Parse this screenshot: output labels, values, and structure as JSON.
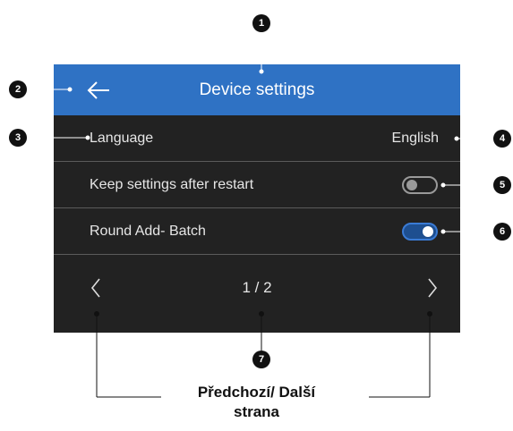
{
  "header": {
    "title": "Device settings",
    "back_icon": "arrow-left-icon"
  },
  "settings": [
    {
      "label": "Language",
      "value": "English"
    },
    {
      "label": "Keep settings after restart",
      "toggle": false
    },
    {
      "label": "Round Add- Batch",
      "toggle": true
    }
  ],
  "pager": {
    "indicator": "1 / 2",
    "prev_icon": "chevron-left-icon",
    "next_icon": "chevron-right-icon"
  },
  "callouts": [
    "1",
    "2",
    "3",
    "4",
    "5",
    "6",
    "7"
  ],
  "caption": {
    "line1": "Předchozí/ Další",
    "line2": "strana"
  },
  "colors": {
    "header_bg": "#2f72c4",
    "screen_bg": "#222222",
    "toggle_on": "#3a7bd5",
    "toggle_off": "#9a9a9a"
  }
}
